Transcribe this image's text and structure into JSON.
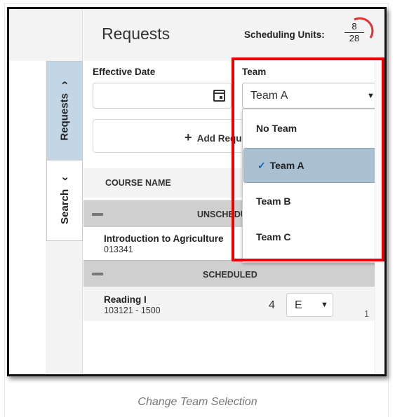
{
  "header": {
    "title": "Requests",
    "scheduling_units_label": "Scheduling Units:",
    "units_used": "8",
    "units_total": "28"
  },
  "side_tabs": {
    "requests_label": "Requests",
    "search_label": "Search",
    "requests_icon": "chevron-right-icon",
    "search_icon": "chevron-left-icon"
  },
  "form": {
    "effective_date_label": "Effective Date",
    "effective_date_value": "",
    "calendar_icon": "calendar-icon",
    "add_button_label": "Add Requ",
    "add_button_icon": "plus-icon"
  },
  "team": {
    "label": "Team",
    "selected": "Team A",
    "options": [
      {
        "label": "No Team",
        "selected": false
      },
      {
        "label": "Team A",
        "selected": true
      },
      {
        "label": "Team B",
        "selected": false
      },
      {
        "label": "Team C",
        "selected": false
      }
    ],
    "check_mark": "✓"
  },
  "table": {
    "column_header": "COURSE NAME",
    "groups": [
      {
        "label": "UNSCHEDU",
        "courses": [
          {
            "name": "Introduction to Agriculture",
            "code": "013341"
          }
        ]
      },
      {
        "label": "SCHEDULED",
        "courses": [
          {
            "name": "Reading I",
            "code": "103121 - 1500",
            "qty": "4",
            "period": "E",
            "index": "1"
          }
        ]
      }
    ]
  },
  "caption": "Change Team Selection",
  "colors": {
    "highlight": "#ee0000",
    "active_tab": "#c3d6e6",
    "selected_option": "#a9bfd2",
    "units_arc": "#e03030"
  }
}
